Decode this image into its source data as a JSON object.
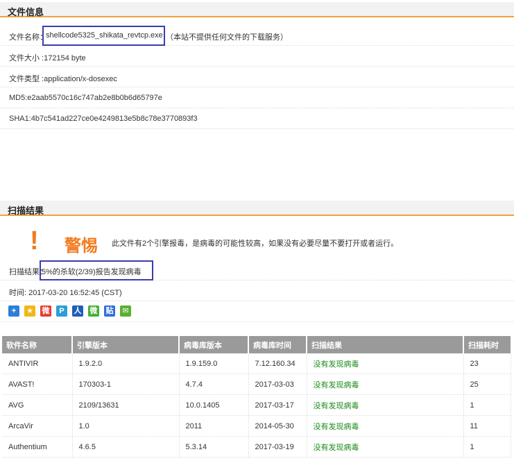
{
  "file_info": {
    "header": "文件信息",
    "file_name_label": "文件名称：",
    "file_name": "shellcode5325_shikata_revtcp.exe",
    "file_name_note": "（本站不提供任何文件的下载服务）",
    "size": "文件大小 :172154 byte",
    "type": "文件类型 :application/x-dosexec",
    "md5": "MD5:e2aab5570c16c747ab2e8b0b6d65797e",
    "sha1": "SHA1:4b7c541ad227ce0e4249813e5b8c78e3770893f3"
  },
  "scan": {
    "header": "扫描结果",
    "warn_icon": "!",
    "warn_title": "警惕",
    "warn_text": "此文件有2个引擎报毒，是病毒的可能性较高，如果没有必要尽量不要打开或者运行。",
    "result_label": "扫描结果：",
    "result_value": "5%的杀软(2/39)报告发现病毒",
    "time": "时间: 2017-03-20 16:52:45 (CST)"
  },
  "share_icons": [
    {
      "name": "share-plus-icon",
      "glyph": "+",
      "color": "#2b7fd8"
    },
    {
      "name": "share-qzone-icon",
      "glyph": "★",
      "color": "#f2b619"
    },
    {
      "name": "share-weibo-icon",
      "glyph": "微",
      "color": "#e33e33"
    },
    {
      "name": "share-tqq-icon",
      "glyph": "P",
      "color": "#2a9fd6"
    },
    {
      "name": "share-renren-icon",
      "glyph": "人",
      "color": "#1f5fb8"
    },
    {
      "name": "share-wechat-icon",
      "glyph": "微",
      "color": "#45b035"
    },
    {
      "name": "share-tieba-icon",
      "glyph": "贴",
      "color": "#3070d8"
    },
    {
      "name": "share-mail-icon",
      "glyph": "✉",
      "color": "#5ab030"
    }
  ],
  "table": {
    "columns": [
      "软件名称",
      "引擎版本",
      "病毒库版本",
      "病毒库时间",
      "扫描结果",
      "扫描耗时"
    ],
    "rows": [
      [
        "ANTIVIR",
        "1.9.2.0",
        "1.9.159.0",
        "7.12.160.34",
        "没有发现病毒",
        "23"
      ],
      [
        "AVAST!",
        "170303-1",
        "4.7.4",
        "2017-03-03",
        "没有发现病毒",
        "25"
      ],
      [
        "AVG",
        "2109/13631",
        "10.0.1405",
        "2017-03-17",
        "没有发现病毒",
        "1"
      ],
      [
        "ArcaVir",
        "1.0",
        "2011",
        "2014-05-30",
        "没有发现病毒",
        "11"
      ],
      [
        "Authentium",
        "4.6.5",
        "5.3.14",
        "2017-03-19",
        "没有发现病毒",
        "1"
      ]
    ]
  }
}
